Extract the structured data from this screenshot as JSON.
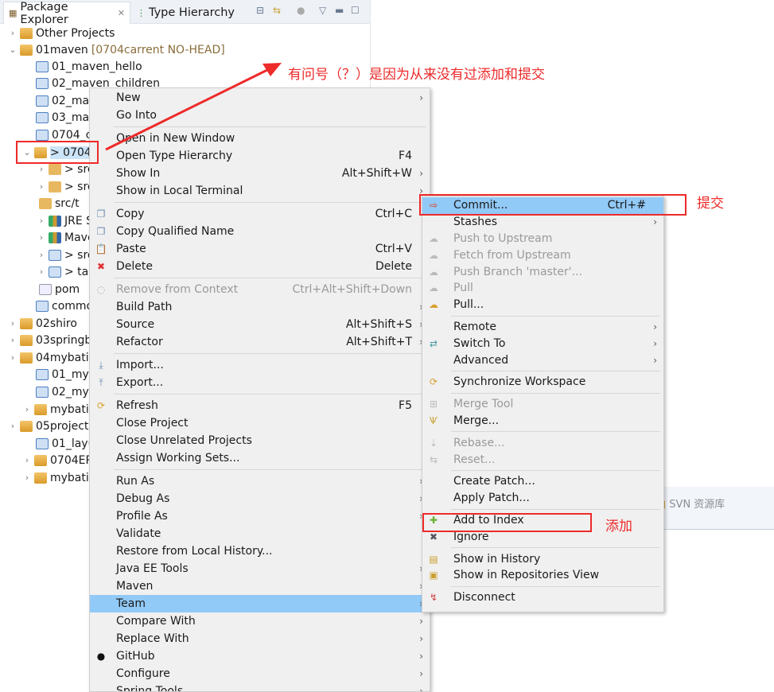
{
  "tabs": {
    "package_explorer": "Package Explorer",
    "type_hierarchy": "Type Hierarchy"
  },
  "tree": [
    {
      "label": "Other Projects",
      "expanded": false,
      "icon": "working-set-icon"
    },
    {
      "label": "01maven",
      "decoration": "[0704carrent NO-HEAD]",
      "expanded": true,
      "icon": "project-icon"
    },
    {
      "label": "01_maven_hello",
      "icon": "folder-icon"
    },
    {
      "label": "02_maven_children",
      "icon": "folder-icon"
    },
    {
      "label": "02_mav",
      "icon": "folder-icon"
    },
    {
      "label": "03_mav",
      "icon": "folder-icon"
    },
    {
      "label": "0704_c",
      "icon": "folder-icon"
    },
    {
      "label": "> 0704",
      "expanded": true,
      "selected": true,
      "icon": "maven-project-icon"
    },
    {
      "label": "> src",
      "icon": "package-icon"
    },
    {
      "label": "> src",
      "icon": "package-icon"
    },
    {
      "label": "src/t",
      "icon": "package-icon"
    },
    {
      "label": "JRE S",
      "icon": "library-icon"
    },
    {
      "label": "Mave",
      "icon": "library-icon"
    },
    {
      "label": "> src",
      "icon": "folder-icon"
    },
    {
      "label": "> tar",
      "icon": "folder-icon"
    },
    {
      "label": "pom",
      "icon": "file-icon"
    },
    {
      "label": "commo",
      "icon": "folder-icon"
    },
    {
      "label": "02shiro",
      "icon": "project-icon"
    },
    {
      "label": "03springb",
      "icon": "project-icon"
    },
    {
      "label": "04mybatis",
      "icon": "project-icon"
    },
    {
      "label": "01_myb",
      "icon": "folder-icon"
    },
    {
      "label": "02_myb",
      "icon": "folder-icon"
    },
    {
      "label": "mybati",
      "icon": "maven-project-icon"
    },
    {
      "label": "05project",
      "icon": "project-icon"
    },
    {
      "label": "01_layu",
      "icon": "folder-icon"
    },
    {
      "label": "0704ER",
      "icon": "maven-project-icon"
    },
    {
      "label": "mybati",
      "icon": "maven-project-icon"
    }
  ],
  "svn_tab": "SVN 资源库",
  "context_menu": [
    {
      "label": "New",
      "submenu": true
    },
    {
      "label": "Go Into"
    },
    {
      "sep": true
    },
    {
      "label": "Open in New Window"
    },
    {
      "label": "Open Type Hierarchy",
      "shortcut": "F4"
    },
    {
      "label": "Show In",
      "shortcut": "Alt+Shift+W",
      "submenu": true
    },
    {
      "label": "Show in Local Terminal",
      "submenu": true
    },
    {
      "sep": true
    },
    {
      "label": "Copy",
      "shortcut": "Ctrl+C",
      "icon": "copy-icon"
    },
    {
      "label": "Copy Qualified Name",
      "icon": "copy-qualified-icon"
    },
    {
      "label": "Paste",
      "shortcut": "Ctrl+V",
      "icon": "paste-icon"
    },
    {
      "label": "Delete",
      "shortcut": "Delete",
      "icon": "delete-icon"
    },
    {
      "sep": true
    },
    {
      "label": "Remove from Context",
      "shortcut": "Ctrl+Alt+Shift+Down",
      "disabled": true,
      "icon": "remove-context-icon"
    },
    {
      "label": "Build Path",
      "submenu": true
    },
    {
      "label": "Source",
      "shortcut": "Alt+Shift+S",
      "submenu": true
    },
    {
      "label": "Refactor",
      "shortcut": "Alt+Shift+T",
      "submenu": true
    },
    {
      "sep": true
    },
    {
      "label": "Import...",
      "icon": "import-icon"
    },
    {
      "label": "Export...",
      "icon": "export-icon"
    },
    {
      "sep": true
    },
    {
      "label": "Refresh",
      "shortcut": "F5",
      "icon": "refresh-icon"
    },
    {
      "label": "Close Project"
    },
    {
      "label": "Close Unrelated Projects"
    },
    {
      "label": "Assign Working Sets..."
    },
    {
      "sep": true
    },
    {
      "label": "Run As",
      "submenu": true
    },
    {
      "label": "Debug As",
      "submenu": true
    },
    {
      "label": "Profile As",
      "submenu": true
    },
    {
      "label": "Validate"
    },
    {
      "label": "Restore from Local History..."
    },
    {
      "label": "Java EE Tools",
      "submenu": true
    },
    {
      "label": "Maven",
      "submenu": true
    },
    {
      "label": "Team",
      "submenu": true,
      "highlighted": true
    },
    {
      "label": "Compare With",
      "submenu": true
    },
    {
      "label": "Replace With",
      "submenu": true
    },
    {
      "label": "GitHub",
      "submenu": true,
      "icon": "github-icon"
    },
    {
      "label": "Configure",
      "submenu": true
    },
    {
      "label": "Spring Tools",
      "submenu": true
    }
  ],
  "team_menu": [
    {
      "label": "Commit...",
      "shortcut": "Ctrl+#",
      "highlighted": true,
      "icon": "commit-icon"
    },
    {
      "label": "Stashes",
      "submenu": true
    },
    {
      "label": "Push to Upstream",
      "disabled": true,
      "icon": "push-icon"
    },
    {
      "label": "Fetch from Upstream",
      "disabled": true,
      "icon": "fetch-icon"
    },
    {
      "label": "Push Branch 'master'...",
      "disabled": true,
      "icon": "push-branch-icon"
    },
    {
      "label": "Pull",
      "disabled": true,
      "icon": "pull-icon"
    },
    {
      "label": "Pull...",
      "icon": "pull-dialog-icon"
    },
    {
      "sep": true
    },
    {
      "label": "Remote",
      "submenu": true
    },
    {
      "label": "Switch To",
      "submenu": true,
      "icon": "switch-icon"
    },
    {
      "label": "Advanced",
      "submenu": true
    },
    {
      "sep": true
    },
    {
      "label": "Synchronize Workspace",
      "icon": "sync-icon"
    },
    {
      "sep": true
    },
    {
      "label": "Merge Tool",
      "disabled": true,
      "icon": "merge-tool-icon"
    },
    {
      "label": "Merge...",
      "icon": "merge-icon"
    },
    {
      "sep": true
    },
    {
      "label": "Rebase...",
      "disabled": true,
      "icon": "rebase-icon"
    },
    {
      "label": "Reset...",
      "disabled": true,
      "icon": "reset-icon"
    },
    {
      "sep": true
    },
    {
      "label": "Create Patch..."
    },
    {
      "label": "Apply Patch..."
    },
    {
      "sep": true
    },
    {
      "label": "Add to Index",
      "icon": "add-icon"
    },
    {
      "label": "Ignore",
      "icon": "ignore-icon"
    },
    {
      "sep": true
    },
    {
      "label": "Show in History",
      "icon": "history-icon"
    },
    {
      "label": "Show in Repositories View",
      "icon": "repository-icon"
    },
    {
      "sep": true
    },
    {
      "label": "Disconnect",
      "icon": "disconnect-icon"
    }
  ],
  "annotations": {
    "question": "有问号（？）是因为从来没有过添加和提交",
    "commit": "提交",
    "add": "添加",
    "color": "#ee2a2a"
  }
}
